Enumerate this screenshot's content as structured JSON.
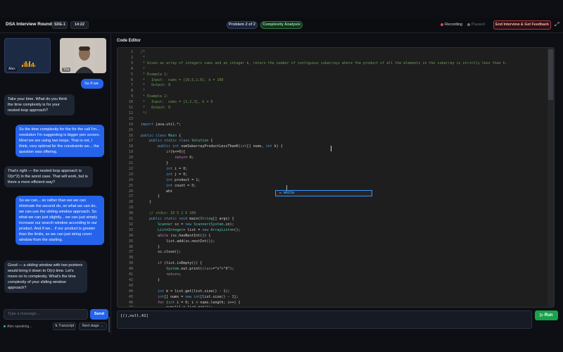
{
  "header": {
    "title": "DSA Interview Round",
    "level": "SDE-1",
    "timer": "14:22",
    "problem": "Problem 2 of 2",
    "phase": "Complexity Analysis",
    "recording": "Recording",
    "paused": "Paused",
    "end_button": "End Interview & Get Feedback",
    "fullscreen_icon": "expand-icon"
  },
  "video": {
    "interviewer_name": "Alex",
    "candidate_name": "You"
  },
  "chat": {
    "messages": [
      {
        "from": "candidate",
        "text": "So if we"
      },
      {
        "from": "interviewer",
        "text": "Take your time. What do you think the time complexity is for your nested-loop approach?"
      },
      {
        "from": "candidate",
        "text": "So the time complexity for the for the call I'm... resolution I'm suggesting is bigger pen screen. Most we are using two loops. That is not, I think, very optimal for the constraints we... the question was offering."
      },
      {
        "from": "interviewer",
        "text": "That's right — the nested loop approach is O(n^2) in the worst case. That will work, but is there a more efficient way?"
      },
      {
        "from": "candidate",
        "text": "So we can... so rather than we we can eliminate the second do, so what we can do, we can use the sliding window approach. So what we can just slightly... we can just simply increase our search window according to our product. And if we... if our product is greater than the limits, so we can just string cover window from the starting."
      },
      {
        "from": "interviewer",
        "text": "Good — a sliding window with two pointers would bring it down to O(n) time. Let's move on to complexity. What's the time complexity of your sliding window approach?"
      }
    ],
    "input_placeholder": "Type a message...",
    "send_label": "Send",
    "speaking_status": "Alex speaking...",
    "transcript_label": "⇅ Transcript",
    "next_stage_label": "Next stage →"
  },
  "editor": {
    "title": "Code Editor",
    "lines": [
      "/*",
      " *",
      " * Given an array of integers nums and an integer k, return the number of contiguous subarrays where the product of all the elements in the subarray is strictly less than k.",
      " *",
      " * Example 1:",
      " *   Input:  nums = [10,5,2,6], k = 100",
      " *   Output: 8",
      " *",
      " * Example 2:",
      " *   Input:  nums = [1,2,3], k = 0",
      " *   Output: 0",
      " */",
      "",
      "import java.util.*;",
      "",
      "public class Main {",
      "    public static class Solution {",
      "        public int numSubarrayProductLessThanK(int[] nums, int k) {",
      "            if(k<=0){",
      "                return 0;",
      "            }",
      "            int i = 0;",
      "            int j = 0;",
      "            int product = 1;",
      "            int count = 0;",
      "            whi",
      "        }",
      "    }",
      "",
      "    // stdin: 10 5 2 6 100",
      "    public static void main(String[] args) {",
      "        Scanner sc = new Scanner(System.in);",
      "        List<Integer> list = new ArrayList<>();",
      "        while (sc.hasNextInt()) {",
      "            list.add(sc.nextInt());",
      "        }",
      "        sc.close();",
      "",
      "        if (list.isEmpty()) {",
      "            System.out.print(\"0\");",
      "            return;",
      "        }",
      "",
      "        int k = list.get(list.size() - 1);",
      "        int[] nums = new int[list.size() - 1];",
      "        for (int i = 0; i < nums.length; i++) {",
      "            nums[i] = list.get(i);"
    ],
    "suggestion": "while",
    "suggestion_icon": "snippet-icon"
  },
  "console": {
    "input": "[(),null,42]",
    "run_label": "▷ Run"
  },
  "colors": {
    "accent": "#2563eb",
    "run": "#16a34a",
    "danger": "#b33a3a",
    "phase": "#2f7a45"
  }
}
